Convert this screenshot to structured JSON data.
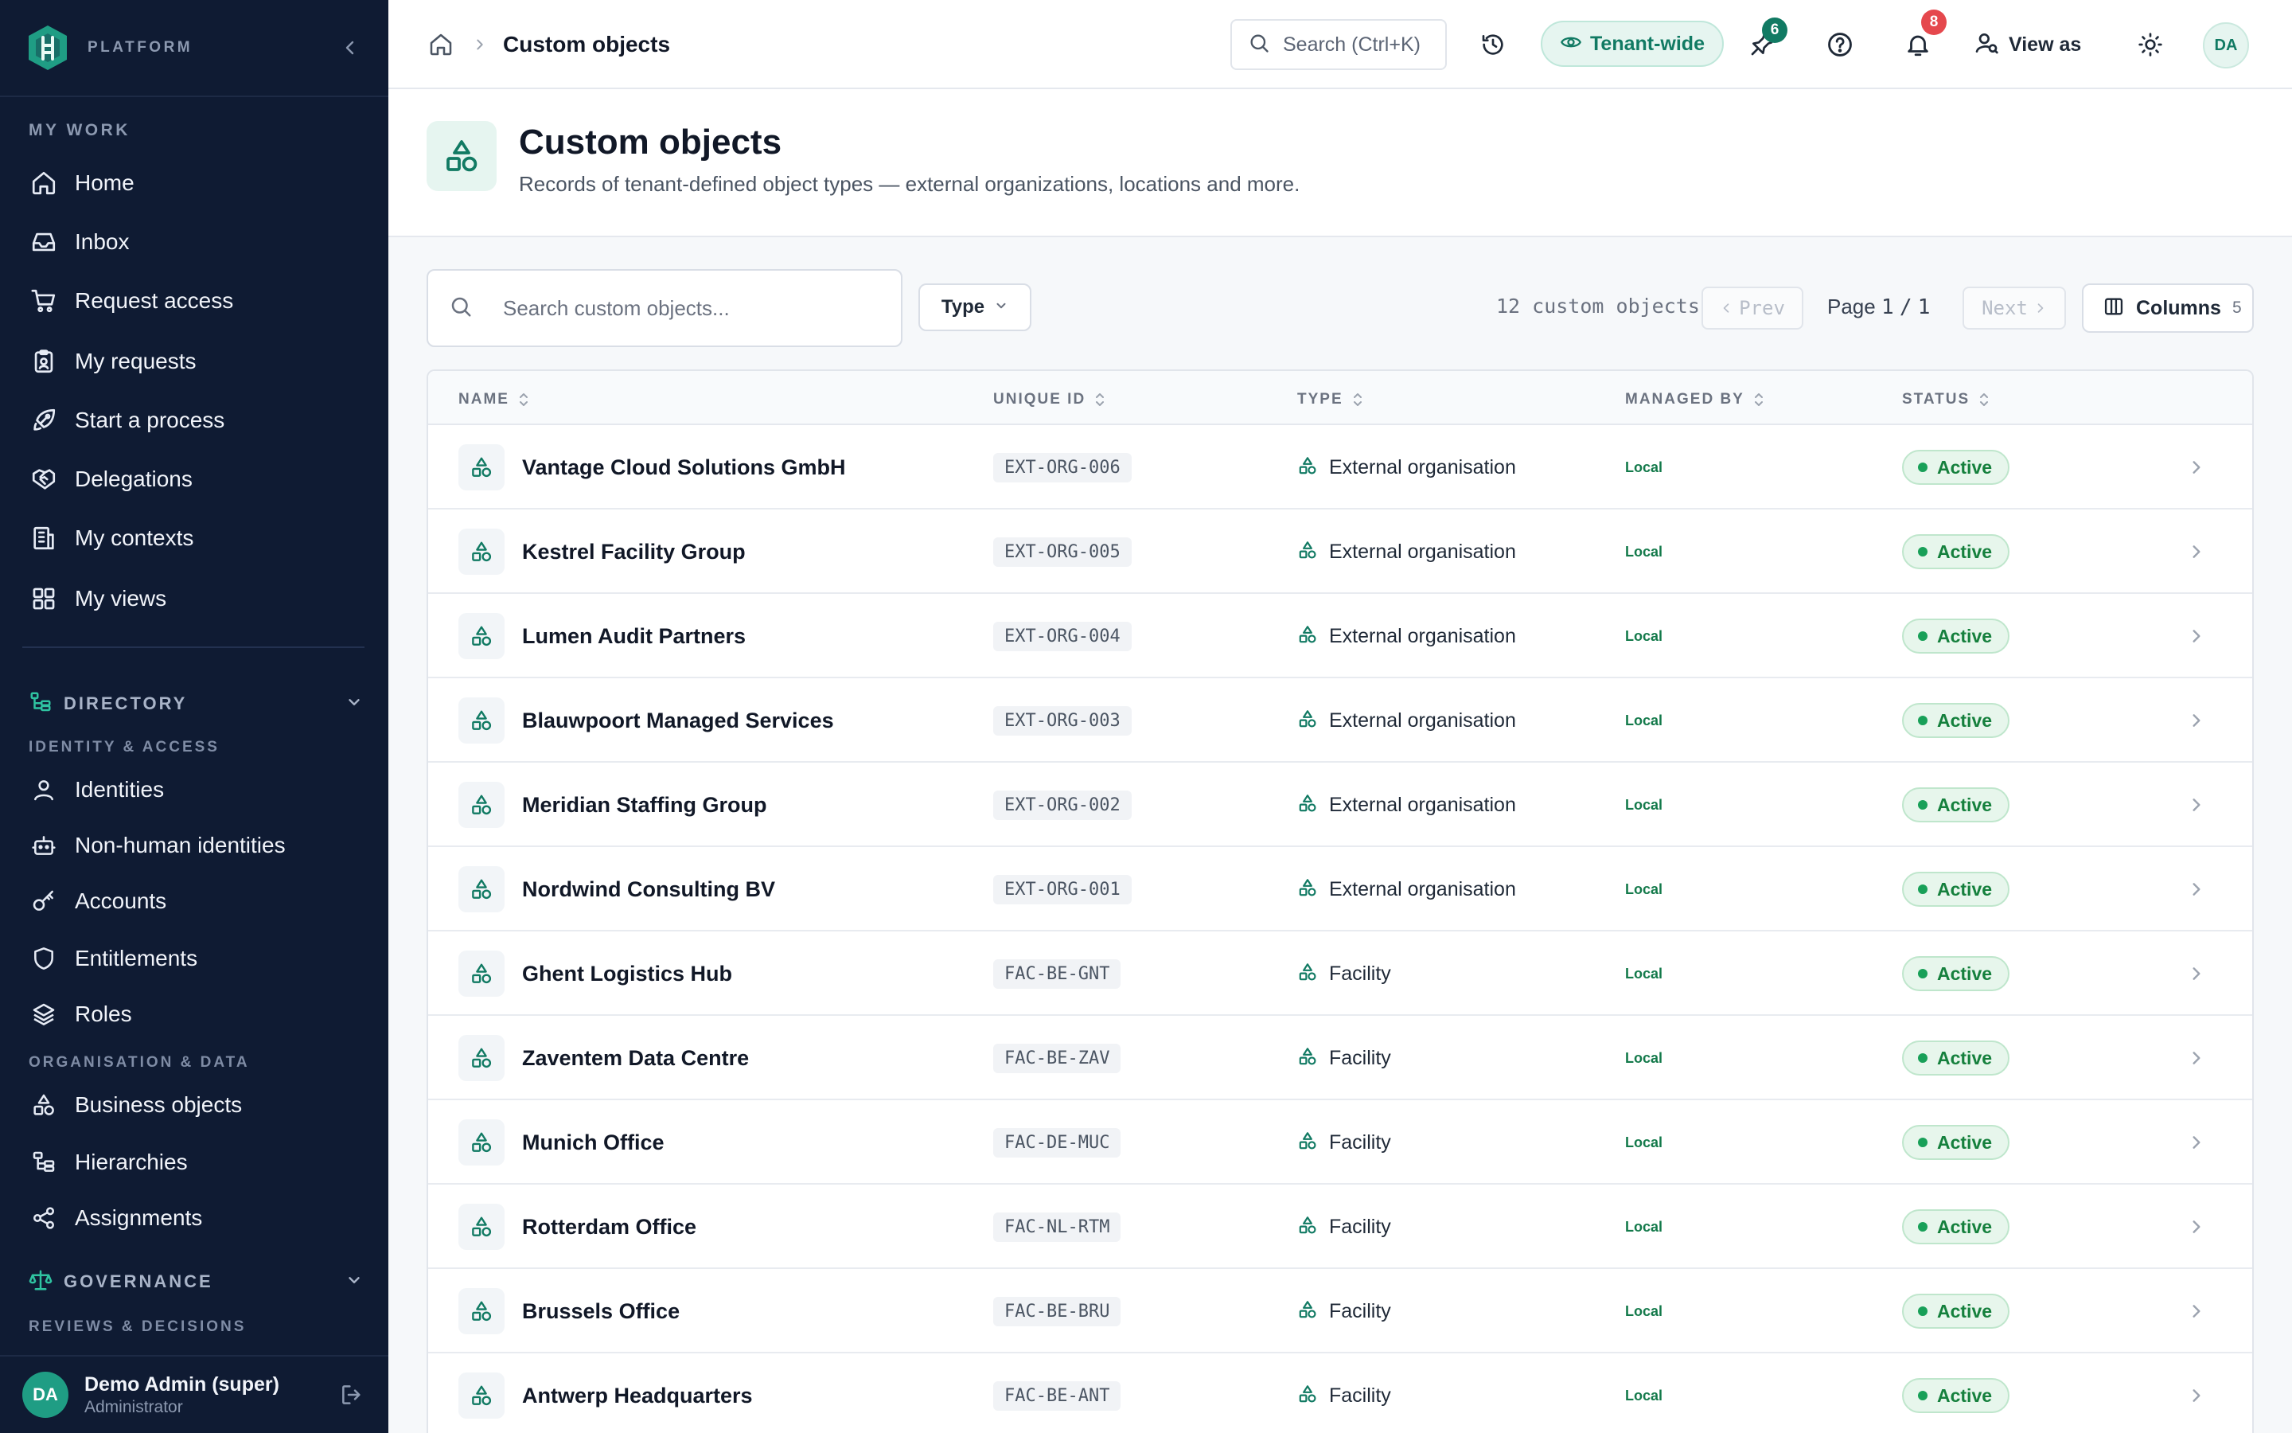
{
  "sidebar": {
    "brand": "PLATFORM",
    "my_work_title": "MY WORK",
    "my_work": [
      {
        "label": "Home",
        "icon": "home-icon"
      },
      {
        "label": "Inbox",
        "icon": "inbox-icon"
      },
      {
        "label": "Request access",
        "icon": "cart-icon"
      },
      {
        "label": "My requests",
        "icon": "clipboard-icon"
      },
      {
        "label": "Start a process",
        "icon": "rocket-icon"
      },
      {
        "label": "Delegations",
        "icon": "handshake-icon"
      },
      {
        "label": "My contexts",
        "icon": "building-icon"
      },
      {
        "label": "My views",
        "icon": "grid-icon"
      }
    ],
    "directory": {
      "title": "DIRECTORY",
      "sub_identity": "IDENTITY & ACCESS",
      "identity_items": [
        {
          "label": "Identities",
          "icon": "user-icon"
        },
        {
          "label": "Non-human identities",
          "icon": "bot-icon"
        },
        {
          "label": "Accounts",
          "icon": "key-icon"
        },
        {
          "label": "Entitlements",
          "icon": "shield-icon"
        },
        {
          "label": "Roles",
          "icon": "layers-icon"
        }
      ],
      "sub_org": "ORGANISATION & DATA",
      "org_items": [
        {
          "label": "Business objects",
          "icon": "shapes-icon"
        },
        {
          "label": "Hierarchies",
          "icon": "hierarchy-icon"
        },
        {
          "label": "Assignments",
          "icon": "share-icon"
        }
      ]
    },
    "governance": {
      "title": "GOVERNANCE",
      "sub": "REVIEWS & DECISIONS"
    },
    "user": {
      "initials": "DA",
      "name": "Demo Admin (super)",
      "role": "Administrator"
    }
  },
  "topbar": {
    "breadcrumb_current": "Custom objects",
    "search_placeholder": "Search (Ctrl+K)",
    "tenant_label": "Tenant-wide",
    "pinned_badge": "6",
    "notifications_badge": "8",
    "view_as_label": "View as",
    "avatar_initials": "DA"
  },
  "page": {
    "title": "Custom objects",
    "subtitle": "Records of tenant-defined object types — external organizations, locations and more."
  },
  "toolbar": {
    "search_placeholder": "Search custom objects...",
    "type_filter": "Type",
    "count_text": "12 custom objects",
    "prev_label": "Prev",
    "next_label": "Next",
    "page_label": "Page",
    "page_current": "1",
    "page_sep": "/",
    "page_total": "1",
    "columns_label": "Columns",
    "columns_count": "5"
  },
  "table": {
    "columns": [
      "NAME",
      "UNIQUE ID",
      "TYPE",
      "MANAGED BY",
      "STATUS"
    ],
    "rows": [
      {
        "name": "Vantage Cloud Solutions GmbH",
        "uid": "EXT-ORG-006",
        "type": "External organisation",
        "managed": "Local",
        "status": "Active"
      },
      {
        "name": "Kestrel Facility Group",
        "uid": "EXT-ORG-005",
        "type": "External organisation",
        "managed": "Local",
        "status": "Active"
      },
      {
        "name": "Lumen Audit Partners",
        "uid": "EXT-ORG-004",
        "type": "External organisation",
        "managed": "Local",
        "status": "Active"
      },
      {
        "name": "Blauwpoort Managed Services",
        "uid": "EXT-ORG-003",
        "type": "External organisation",
        "managed": "Local",
        "status": "Active"
      },
      {
        "name": "Meridian Staffing Group",
        "uid": "EXT-ORG-002",
        "type": "External organisation",
        "managed": "Local",
        "status": "Active"
      },
      {
        "name": "Nordwind Consulting BV",
        "uid": "EXT-ORG-001",
        "type": "External organisation",
        "managed": "Local",
        "status": "Active"
      },
      {
        "name": "Ghent Logistics Hub",
        "uid": "FAC-BE-GNT",
        "type": "Facility",
        "managed": "Local",
        "status": "Active"
      },
      {
        "name": "Zaventem Data Centre",
        "uid": "FAC-BE-ZAV",
        "type": "Facility",
        "managed": "Local",
        "status": "Active"
      },
      {
        "name": "Munich Office",
        "uid": "FAC-DE-MUC",
        "type": "Facility",
        "managed": "Local",
        "status": "Active"
      },
      {
        "name": "Rotterdam Office",
        "uid": "FAC-NL-RTM",
        "type": "Facility",
        "managed": "Local",
        "status": "Active"
      },
      {
        "name": "Brussels Office",
        "uid": "FAC-BE-BRU",
        "type": "Facility",
        "managed": "Local",
        "status": "Active"
      },
      {
        "name": "Antwerp Headquarters",
        "uid": "FAC-BE-ANT",
        "type": "Facility",
        "managed": "Local",
        "status": "Active"
      }
    ]
  },
  "colors": {
    "sidebar_bg": "#0f1b33",
    "accent": "#117a63",
    "status_green": "#15803d",
    "badge_green": "#117a63",
    "badge_red": "#e5484d"
  }
}
